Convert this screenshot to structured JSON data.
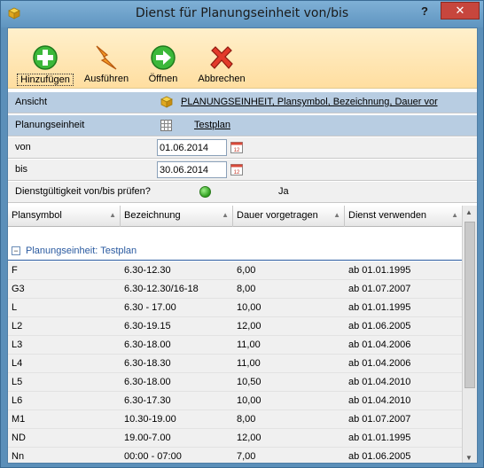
{
  "window": {
    "title": "Dienst für Planungseinheit von/bis",
    "help_label": "?",
    "close_label": "✕"
  },
  "toolbar": {
    "add_label": "Hinzufügen",
    "run_label": "Ausführen",
    "open_label": "Öffnen",
    "cancel_label": "Abbrechen"
  },
  "form": {
    "ansicht_label": "Ansicht",
    "ansicht_value": "PLANUNGSEINHEIT, Plansymbol, Bezeichnung, Dauer vorg",
    "planungseinheit_label": "Planungseinheit",
    "planungseinheit_value": "Testplan",
    "von_label": "von",
    "von_value": "01.06.2014",
    "bis_label": "bis",
    "bis_value": "30.06.2014",
    "check_label": "Dienstgültigkeit von/bis prüfen?",
    "check_value": "Ja"
  },
  "table": {
    "columns": [
      "Plansymbol",
      "Bezeichnung",
      "Dauer vorgetragen",
      "Dienst verwenden"
    ],
    "group_label": "Planungseinheit: Testplan",
    "rows": [
      [
        "F",
        "6.30-12.30",
        "6,00",
        "ab 01.01.1995"
      ],
      [
        "G3",
        "6.30-12.30/16-18",
        "8,00",
        "ab 01.07.2007"
      ],
      [
        "L",
        "6.30 - 17.00",
        "10,00",
        "ab 01.01.1995"
      ],
      [
        "L2",
        "6.30-19.15",
        "12,00",
        "ab 01.06.2005"
      ],
      [
        "L3",
        "6.30-18.00",
        "11,00",
        "ab 01.04.2006"
      ],
      [
        "L4",
        "6.30-18.30",
        "11,00",
        "ab 01.04.2006"
      ],
      [
        "L5",
        "6.30-18.00",
        "10,50",
        "ab 01.04.2010"
      ],
      [
        "L6",
        "6.30-17.30",
        "10,00",
        "ab 01.04.2010"
      ],
      [
        "M1",
        "10.30-19.00",
        "8,00",
        "ab 01.07.2007"
      ],
      [
        "ND",
        "19.00-7.00",
        "12,00",
        "ab 01.01.1995"
      ],
      [
        "Nn",
        "00:00 - 07:00",
        "7,00",
        "ab 01.06.2005"
      ]
    ]
  },
  "colors": {
    "toolbar_bg": "#ffdea0",
    "header_row_bg": "#b8cde2",
    "group_text": "#2a5aa0",
    "close_button": "#c7463d"
  },
  "icons": {
    "add": "green-plus-circle-icon",
    "run": "lightning-bolt-icon",
    "open": "green-arrow-circle-icon",
    "cancel": "red-x-icon",
    "ansicht": "cube-icon",
    "planungseinheit": "grid-icon",
    "calendar": "calendar-icon",
    "status": "green-dot-icon"
  }
}
